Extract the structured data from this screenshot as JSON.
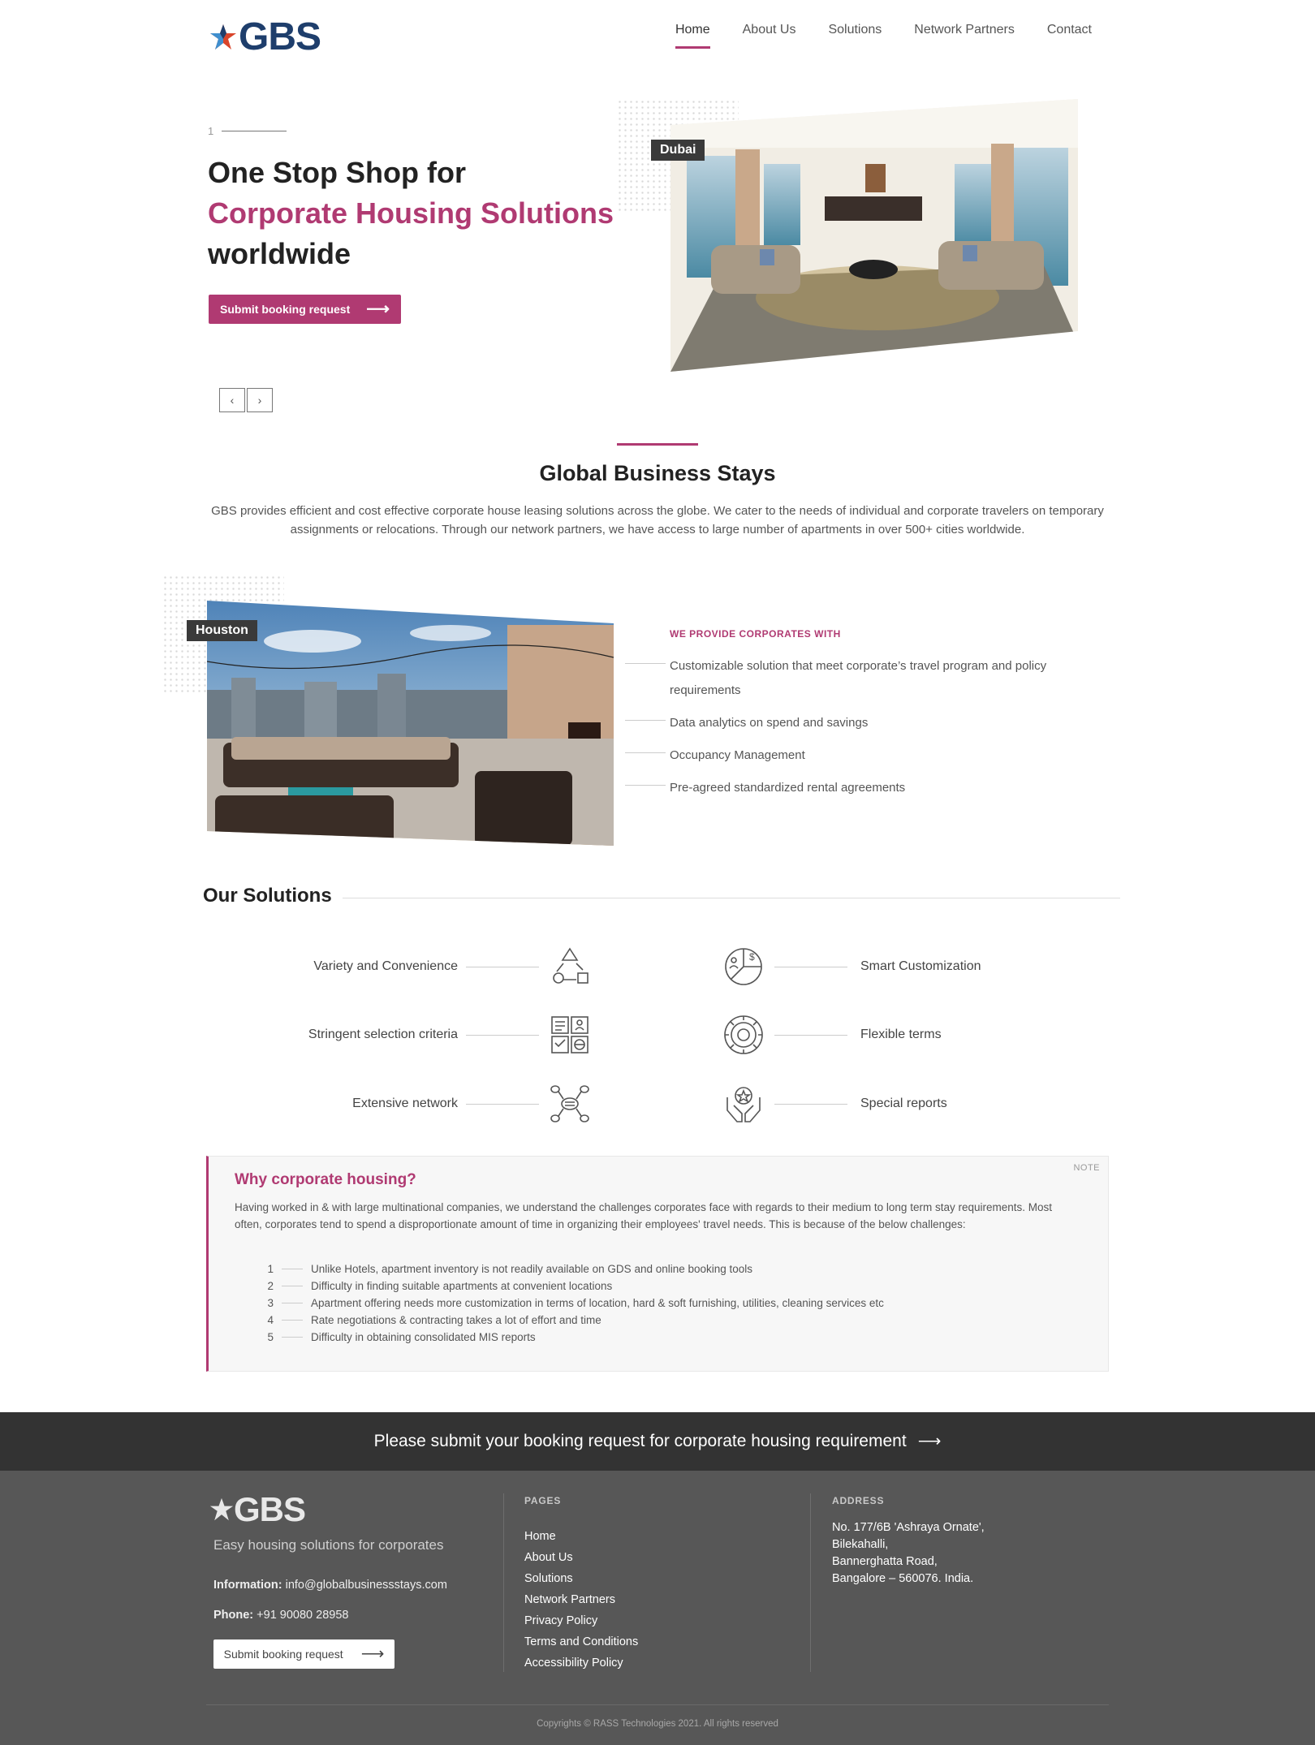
{
  "header": {
    "logo_text": "GBS",
    "nav": [
      "Home",
      "About Us",
      "Solutions",
      "Network Partners",
      "Contact"
    ],
    "active_nav": "Home"
  },
  "hero": {
    "slide_number": "1",
    "title_line1": "One Stop Shop for",
    "title_line2": "Corporate Housing Solutions",
    "title_line3": "worldwide",
    "button_label": "Submit booking request",
    "button_arrow": "⟶",
    "image_tag": "Dubai",
    "prev_icon": "‹",
    "next_icon": "›"
  },
  "about": {
    "title": "Global Business Stays",
    "text": "GBS provides efficient and cost effective corporate house leasing solutions across the globe. We cater to the needs of individual and corporate travelers on temporary assignments or relocations. Through our network partners, we have access to large number of apartments in over 500+ cities worldwide."
  },
  "provide": {
    "image_tag": "Houston",
    "heading": "WE PROVIDE CORPORATES WITH",
    "items": [
      "Customizable solution that meet corporate’s travel program and policy requirements",
      "Data analytics on spend and savings",
      "Occupancy Management",
      "Pre-agreed standardized rental agreements"
    ]
  },
  "solutions": {
    "title": "Our Solutions",
    "left": [
      {
        "label": "Variety and Convenience",
        "icon": "shapes-icon"
      },
      {
        "label": "Stringent selection criteria",
        "icon": "checklist-icon"
      },
      {
        "label": "Extensive network",
        "icon": "network-icon"
      }
    ],
    "right": [
      {
        "label": "Smart Customization",
        "icon": "pie-chart-icon"
      },
      {
        "label": "Flexible terms",
        "icon": "gear-icon"
      },
      {
        "label": "Special reports",
        "icon": "hands-star-icon"
      }
    ]
  },
  "note": {
    "tag": "NOTE",
    "title": "Why corporate housing?",
    "body": "Having worked in & with large multinational companies, we understand the challenges corporates face with regards to their medium to long term stay requirements. Most often, corporates tend to spend a disproportionate amount of time in organizing their employees' travel needs. This is because of the below challenges:",
    "list": [
      {
        "n": "1",
        "text": "Unlike Hotels, apartment inventory is not readily available on GDS and online booking tools"
      },
      {
        "n": "2",
        "text": "Difficulty in finding suitable apartments at convenient locations"
      },
      {
        "n": "3",
        "text": "Apartment offering needs more customization in terms of location, hard & soft furnishing, utilities, cleaning services etc"
      },
      {
        "n": "4",
        "text": "Rate negotiations & contracting takes a lot of effort and time"
      },
      {
        "n": "5",
        "text": "Difficulty in obtaining consolidated MIS reports"
      }
    ]
  },
  "cta": {
    "text": "Please submit your booking request for corporate housing requirement",
    "arrow": "⟶"
  },
  "footer": {
    "logo_text": "GBS",
    "tagline": "Easy housing solutions for corporates",
    "info_label": "Information:",
    "info_value": "info@globalbusinessstays.com",
    "phone_label": "Phone:",
    "phone_value": "+91 90080 28958",
    "button_label": "Submit booking request",
    "button_arrow": "⟶",
    "pages_heading": "PAGES",
    "pages": [
      "Home",
      "About Us",
      "Solutions",
      "Network Partners",
      "Privacy Policy",
      "Terms and Conditions",
      "Accessibility Policy"
    ],
    "address_heading": "ADDRESS",
    "address": [
      "No. 177/6B 'Ashraya Ornate',",
      "Bilekahalli,",
      "Bannerghatta Road,",
      "Bangalore – 560076. India."
    ],
    "copyright": "Copyrights © RASS Technologies 2021. All rights reserved"
  },
  "colors": {
    "accent": "#b03a72",
    "navy": "#1e3e6c",
    "cta_bg": "#333333",
    "footer_bg": "#575757"
  }
}
